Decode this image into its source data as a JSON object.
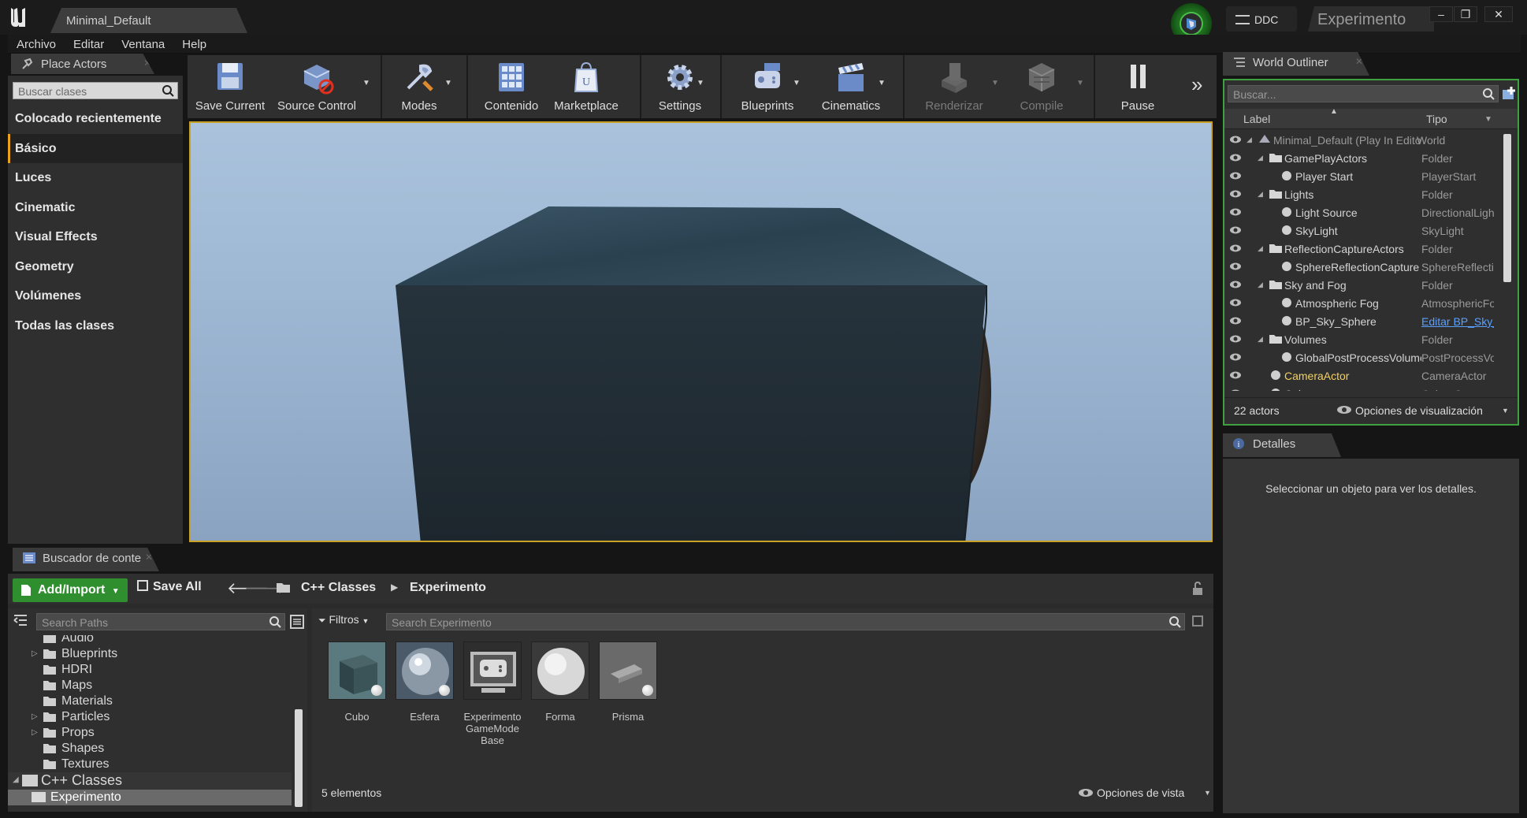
{
  "window": {
    "level_tab": "Minimal_Default",
    "ddc_label": "DDC",
    "project_name": "Experimento"
  },
  "menu": [
    "Archivo",
    "Editar",
    "Ventana",
    "Help"
  ],
  "place_actors": {
    "tab_label": "Place Actors",
    "search_placeholder": "Buscar clases",
    "categories": [
      "Colocado recientemente",
      "Básico",
      "Luces",
      "Cinematic",
      "Visual Effects",
      "Geometry",
      "Volúmenes",
      "Todas las clases"
    ],
    "selected_category": "Básico"
  },
  "toolbar": {
    "save_current": "Save Current",
    "source_control": "Source Control",
    "modes": "Modes",
    "contenido": "Contenido",
    "marketplace": "Marketplace",
    "settings": "Settings",
    "blueprints": "Blueprints",
    "cinematics": "Cinematics",
    "renderizar": "Renderizar",
    "compile": "Compile",
    "pause": "Pause"
  },
  "outliner": {
    "tab_label": "World Outliner",
    "search_placeholder": "Buscar...",
    "col_label": "Label",
    "col_type": "Tipo",
    "rows": [
      {
        "label": "Minimal_Default (Play In Editor)",
        "type": "World"
      },
      {
        "label": "GamePlayActors",
        "type": "Folder"
      },
      {
        "label": "Player Start",
        "type": "PlayerStart"
      },
      {
        "label": "Lights",
        "type": "Folder"
      },
      {
        "label": "Light Source",
        "type": "DirectionalLight"
      },
      {
        "label": "SkyLight",
        "type": "SkyLight"
      },
      {
        "label": "ReflectionCaptureActors",
        "type": "Folder"
      },
      {
        "label": "SphereReflectionCapture",
        "type": "SphereReflectionCapture"
      },
      {
        "label": "Sky and Fog",
        "type": "Folder"
      },
      {
        "label": "Atmospheric Fog",
        "type": "AtmosphericFog"
      },
      {
        "label": "BP_Sky_Sphere",
        "type": "Editar BP_Sky_Sphere"
      },
      {
        "label": "Volumes",
        "type": "Folder"
      },
      {
        "label": "GlobalPostProcessVolume",
        "type": "PostProcessVolume"
      },
      {
        "label": "CameraActor",
        "type": "CameraActor"
      },
      {
        "label": "Cubo",
        "type": "Cubo_C"
      }
    ],
    "actor_count": "22 actors",
    "view_options": "Opciones de visualización"
  },
  "details": {
    "tab_label": "Detalles",
    "empty_message": "Seleccionar un objeto para ver los detalles."
  },
  "content_browser": {
    "tab_label": "Buscador de contenido",
    "add_import": "Add/Import",
    "save_all": "Save All",
    "breadcrumb": [
      "C++ Classes",
      "Experimento"
    ],
    "paths_search_placeholder": "Search Paths",
    "filters_label": "Filtros",
    "asset_search_placeholder": "Search Experimento",
    "tree": [
      {
        "label": "Audio",
        "expandable": false
      },
      {
        "label": "Blueprints",
        "expandable": true
      },
      {
        "label": "HDRI",
        "expandable": false
      },
      {
        "label": "Maps",
        "expandable": false
      },
      {
        "label": "Materials",
        "expandable": false
      },
      {
        "label": "Particles",
        "expandable": true
      },
      {
        "label": "Props",
        "expandable": true
      },
      {
        "label": "Shapes",
        "expandable": false
      },
      {
        "label": "Textures",
        "expandable": false
      }
    ],
    "cpp_classes": "C++ Classes",
    "selected_folder": "Experimento",
    "assets": [
      {
        "name": "Cubo"
      },
      {
        "name": "Esfera"
      },
      {
        "name": "Experimento GameMode Base"
      },
      {
        "name": "Forma"
      },
      {
        "name": "Prisma"
      }
    ],
    "item_count": "5 elementos",
    "view_options": "Opciones de vista"
  }
}
